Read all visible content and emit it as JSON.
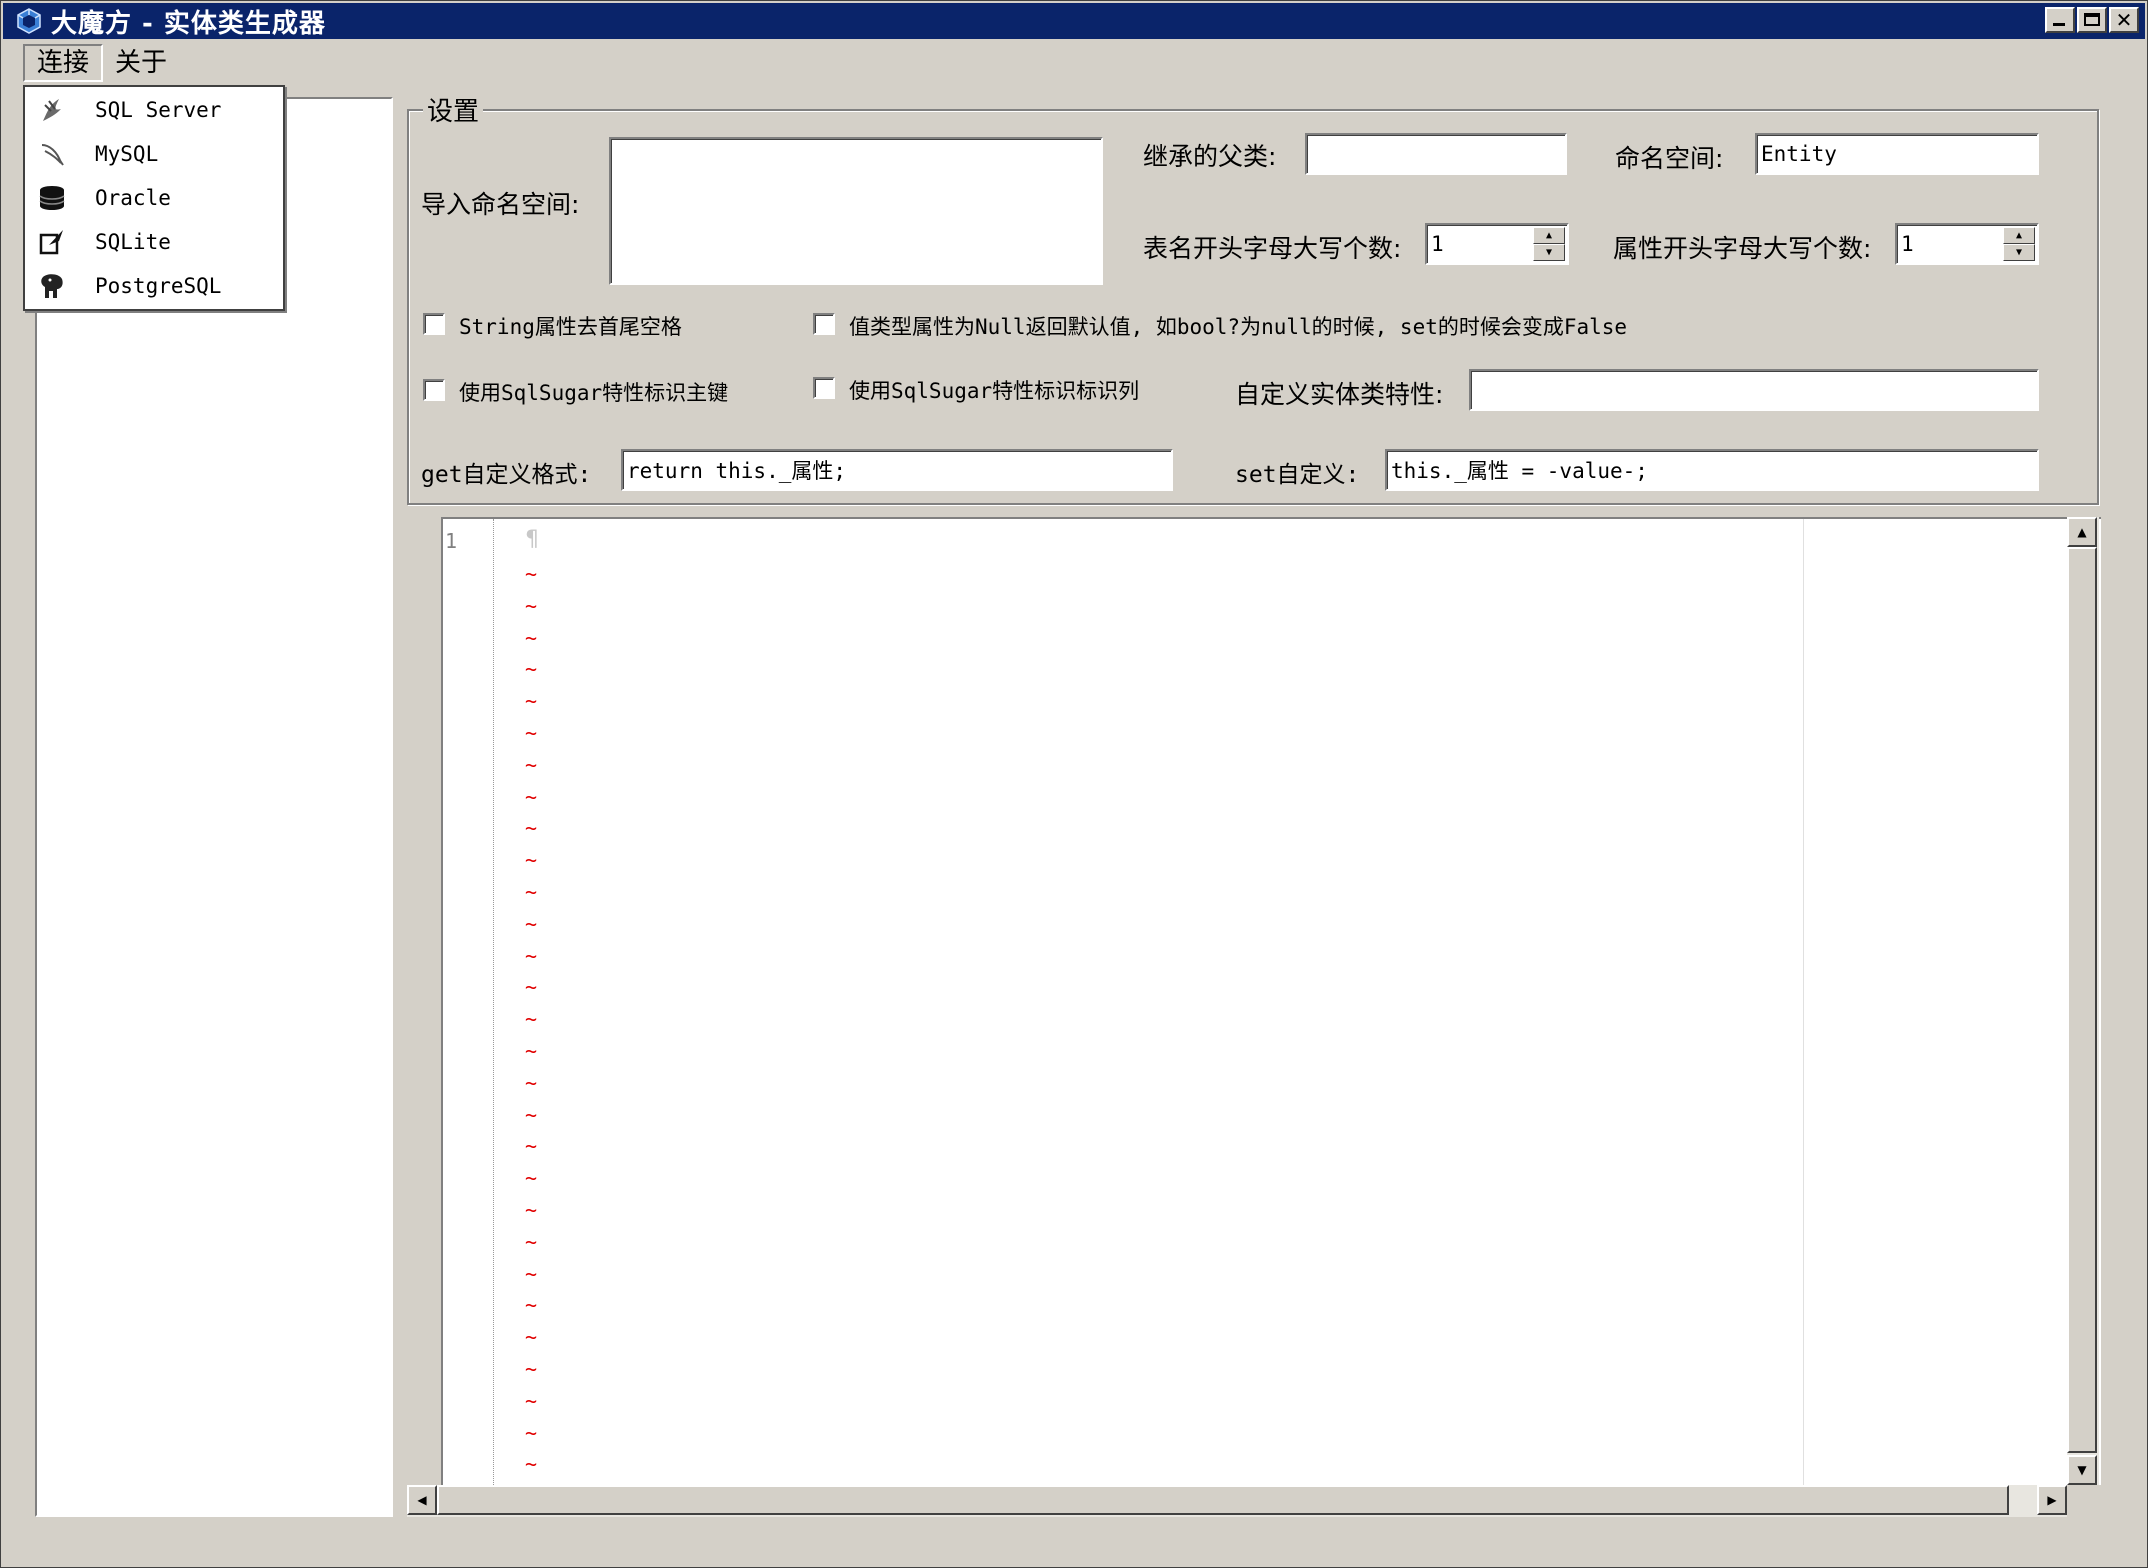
{
  "window": {
    "title": "大魔方 - 实体类生成器",
    "icon": "cube-app-icon"
  },
  "menubar": {
    "items": [
      {
        "label": "连接"
      },
      {
        "label": "关于"
      }
    ]
  },
  "connect_menu": {
    "items": [
      {
        "label": "SQL Server",
        "icon": "sqlserver-icon"
      },
      {
        "label": "MySQL",
        "icon": "mysql-dolphin-icon"
      },
      {
        "label": "Oracle",
        "icon": "database-cylinder-icon"
      },
      {
        "label": "SQLite",
        "icon": "sqlite-feather-icon"
      },
      {
        "label": "PostgreSQL",
        "icon": "postgresql-elephant-icon"
      }
    ]
  },
  "settings": {
    "group_title": "设置",
    "import_namespace_label": "导入命名空间:",
    "import_namespace_value": "",
    "parent_class_label": "继承的父类:",
    "parent_class_value": "",
    "namespace_label": "命名空间:",
    "namespace_value": "Entity",
    "table_upper_label": "表名开头字母大写个数:",
    "table_upper_value": "1",
    "prop_upper_label": "属性开头字母大写个数:",
    "prop_upper_value": "1",
    "chk_string_trim": "String属性去首尾空格",
    "chk_null_default": "值类型属性为Null返回默认值, 如bool?为null的时候, set的时候会变成False",
    "chk_sugar_primary": "使用SqlSugar特性标识主键",
    "chk_sugar_identity": "使用SqlSugar特性标识标识列",
    "custom_attr_label": "自定义实体类特性:",
    "custom_attr_value": "",
    "get_label": "get自定义格式:",
    "get_value": "return this._属性;",
    "set_label": "set自定义:",
    "set_value": "this._属性 = -value-;"
  },
  "editor": {
    "line_number": "1",
    "pilcrow": "¶",
    "tilde_count": 29
  }
}
